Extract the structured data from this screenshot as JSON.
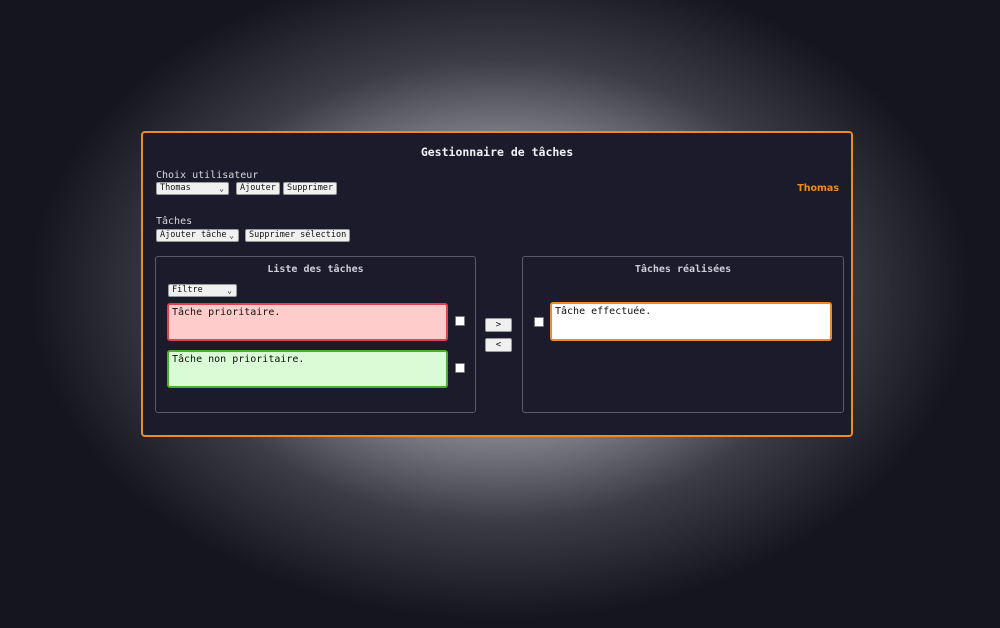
{
  "app": {
    "title": "Gestionnaire de tâches",
    "accent_color": "#f08a24"
  },
  "user_section": {
    "label": "Choix utilisateur",
    "selected_user": "Thomas",
    "add_button": "Ajouter",
    "delete_button": "Supprimer",
    "current_user_display": "Thomas"
  },
  "tasks_section": {
    "label": "Tâches",
    "add_task_select": "Ajouter tâche",
    "delete_selection_button": "Supprimer sélection"
  },
  "task_list": {
    "title": "Liste des tâches",
    "filter_select": "Filtre",
    "items": [
      {
        "text": "Tâche prioritaire.",
        "priority": "high",
        "color": "#ffcccc",
        "border": "#e0434d",
        "checked": false
      },
      {
        "text": "Tâche non prioritaire.",
        "priority": "low",
        "color": "#d9fcd6",
        "border": "#4caf35",
        "checked": false
      }
    ]
  },
  "move_buttons": {
    "to_done": ">",
    "to_list": "<"
  },
  "done_list": {
    "title": "Tâches réalisées",
    "items": [
      {
        "text": "Tâche effectuée.",
        "checked": false
      }
    ]
  }
}
